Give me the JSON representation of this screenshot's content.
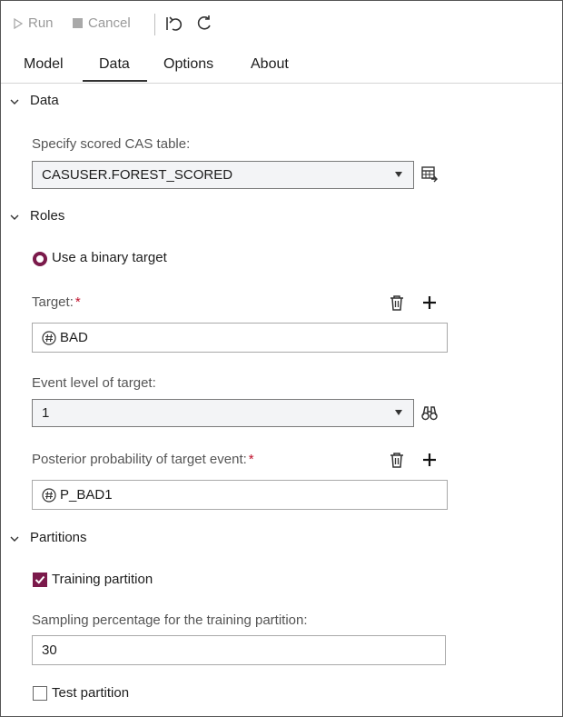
{
  "toolbar": {
    "run_label": "Run",
    "cancel_label": "Cancel",
    "icons": [
      "play-icon",
      "stop-icon",
      "undo-icon",
      "refresh-icon"
    ]
  },
  "tabs": [
    {
      "label": "Model"
    },
    {
      "label": "Data",
      "active": true
    },
    {
      "label": "Options"
    },
    {
      "label": "About"
    }
  ],
  "sections": {
    "data": {
      "title": "Data",
      "table_label": "Specify scored CAS table:",
      "table_value": "CASUSER.FOREST_SCORED"
    },
    "roles": {
      "title": "Roles",
      "binary_target_label": "Use a binary target",
      "target_label": "Target:",
      "target_value": "BAD",
      "event_label": "Event level of target:",
      "event_value": "1",
      "posterior_label": "Posterior probability of target event:",
      "posterior_value": "P_BAD1",
      "required_mark": "*"
    },
    "partitions": {
      "title": "Partitions",
      "training_label": "Training partition",
      "training_checked": true,
      "sampling_label": "Sampling percentage for the training partition:",
      "sampling_value": "30",
      "test_label": "Test partition",
      "test_checked": false
    }
  },
  "colors": {
    "accent": "#7b1a4b",
    "required": "#c0102b",
    "disabled_text": "#9a9a9a"
  }
}
